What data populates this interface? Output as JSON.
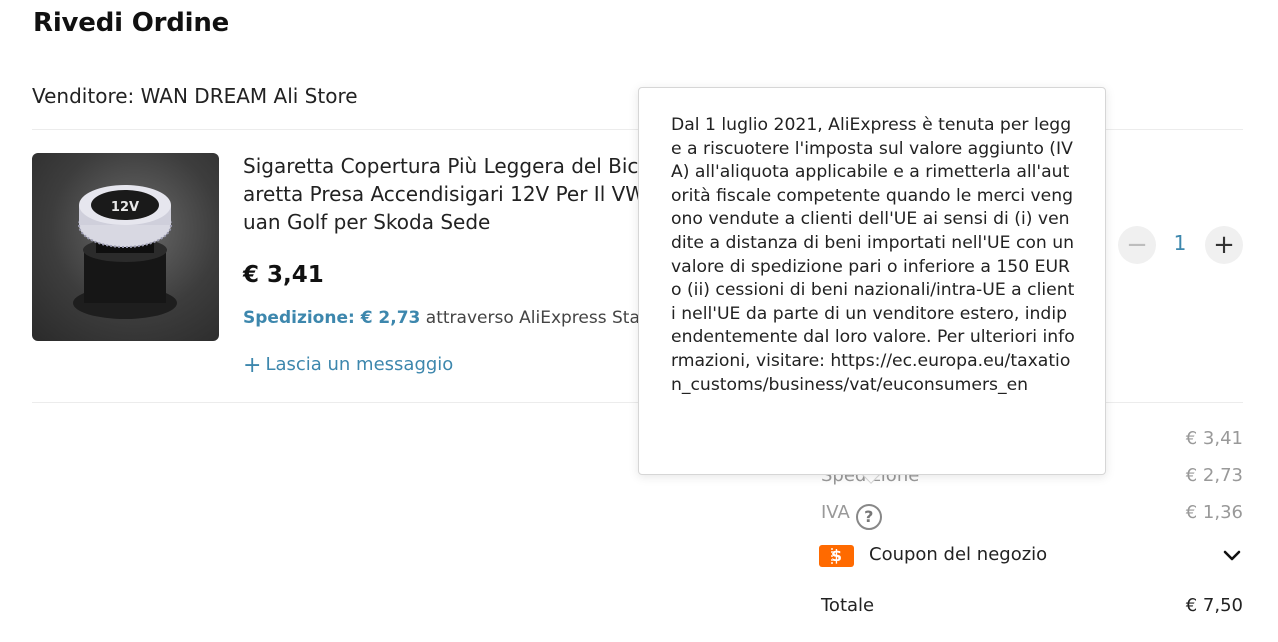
{
  "title": "Rivedi Ordine",
  "seller": "Venditore: WAN DREAM Ali Store",
  "product": {
    "name_lines": [
      "Sigaretta Copertura Più Leggera del Bic",
      "aretta Presa Accendisigari 12V Per Il VW",
      "uan Golf per Skoda Sede"
    ],
    "image_text": "12V",
    "price": "€ 3,41",
    "shipping_label": "Spedizione: € 2,73",
    "shipping_via": "attraverso AliExpress Stan",
    "leave_message_plus": "+",
    "leave_message": "Lascia un messaggio",
    "quantity": "1",
    "qty_minus": "−",
    "qty_plus": "+"
  },
  "summary": {
    "items": [
      {
        "label": "",
        "value": "€ 3,41"
      },
      {
        "label": "Spedizione",
        "value": "€ 2,73"
      },
      {
        "label": "IVA",
        "value": "€ 1,36"
      }
    ],
    "iva_help": "?",
    "coupon_icon_text": "$",
    "coupon_label": "Coupon del negozio",
    "total_label": "Totale",
    "total_value": "€ 7,50"
  },
  "tooltip": {
    "text": "Dal 1 luglio 2021, AliExpress è tenuta per legge a riscuotere l'imposta sul valore aggiunto (IVA) all'aliquota applicabile e a rimetterla all'autorità fiscale competente quando le merci vengono vendute a clienti dell'UE ai sensi di (i) vendite a distanza di beni importati nell'UE con un valore di spedizione pari o inferiore a 150 EUR o (ii) cessioni di beni nazionali/intra-UE a clienti nell'UE da parte di un venditore estero, indipendentemente dal loro valore. Per ulteriori informazioni, visitare: https://ec.europa.eu/taxation_customs/business/vat/euconsumers_en"
  },
  "colors": {
    "accent_blue": "#3d87ad",
    "coupon_orange": "#ff6a00",
    "muted_text": "#999999"
  }
}
